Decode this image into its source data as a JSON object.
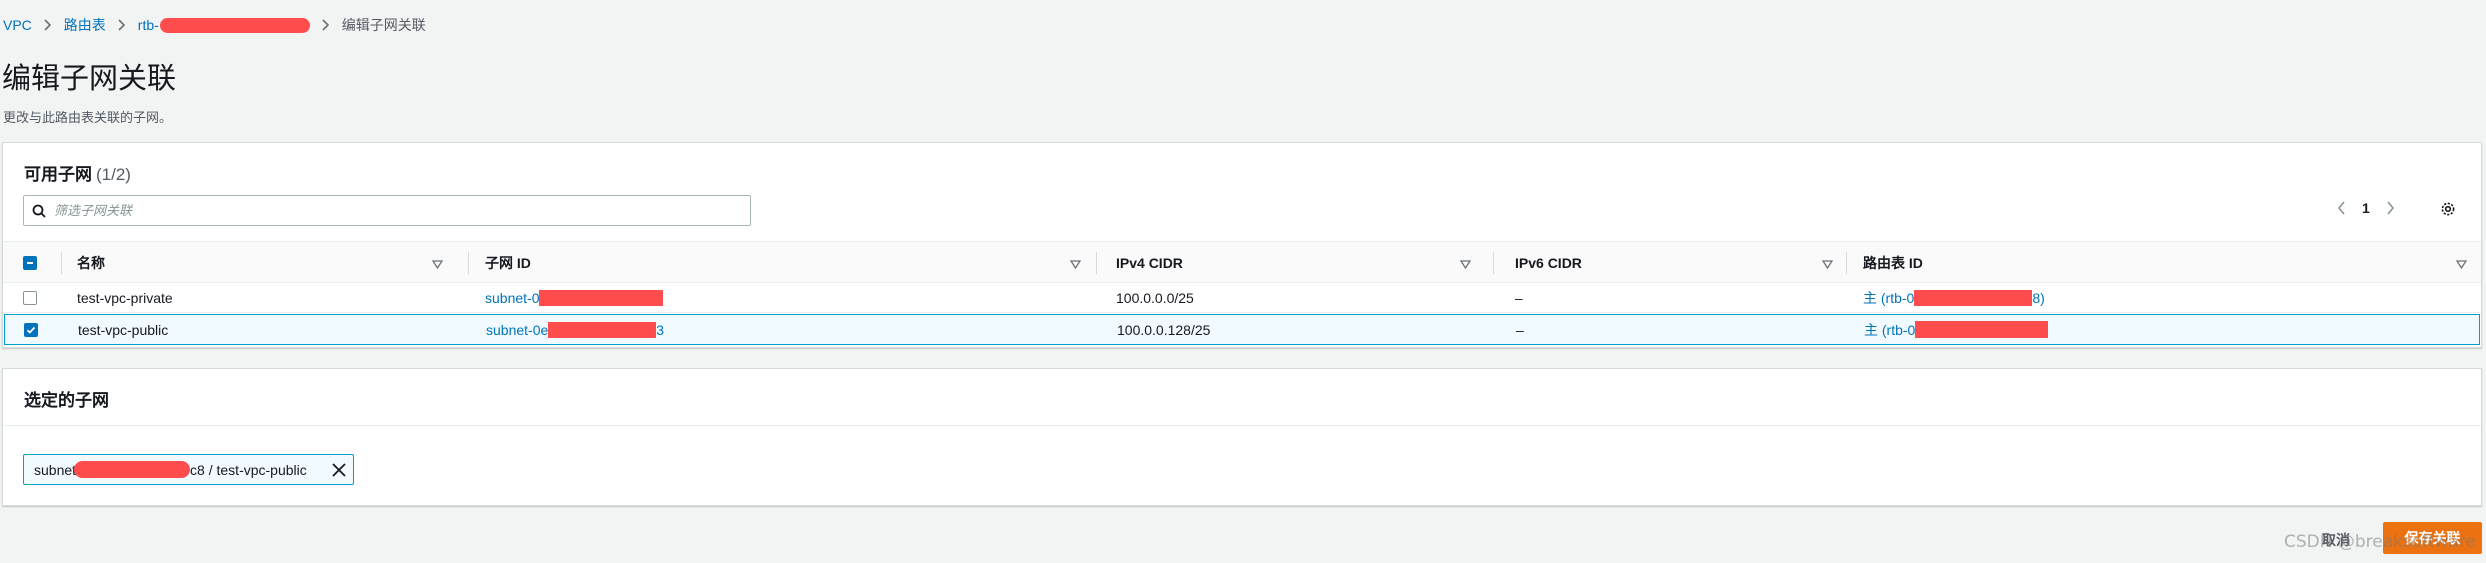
{
  "breadcrumb": {
    "items": [
      "VPC",
      "路由表",
      "rtb-",
      "编辑子网关联"
    ]
  },
  "page": {
    "title": "编辑子网关联",
    "description": "更改与此路由表关联的子网。"
  },
  "subnets_panel": {
    "title": "可用子网",
    "count": "(1/2)",
    "search_placeholder": "筛选子网关联",
    "page_number": "1",
    "columns": [
      "名称",
      "子网 ID",
      "IPv4 CIDR",
      "IPv6 CIDR",
      "路由表 ID"
    ],
    "rows": [
      {
        "name": "test-vpc-private",
        "subnet_id": "subnet-0",
        "ipv4": "100.0.0.0/25",
        "ipv6": "–",
        "route_table": "主 (rtb-0",
        "route_table_suffix": "8)",
        "checked": false
      },
      {
        "name": "test-vpc-public",
        "subnet_id": "subnet-0e",
        "subnet_id_suffix": "3",
        "ipv4": "100.0.0.128/25",
        "ipv6": "–",
        "route_table": "主 (rtb-0",
        "checked": true
      }
    ]
  },
  "selected_panel": {
    "title": "选定的子网",
    "token_prefix": "subnet",
    "token_suffix": "c8 / test-vpc-public"
  },
  "actions": {
    "cancel": "取消",
    "save": "保存关联"
  },
  "watermark": "CSDN @breaksoftware",
  "colors": {
    "link": "#0073bb",
    "accent_orange": "#ec7211",
    "selected_row_bg": "#f1faff",
    "selected_border": "#00a1c9",
    "redaction": "#ff4d4d"
  }
}
